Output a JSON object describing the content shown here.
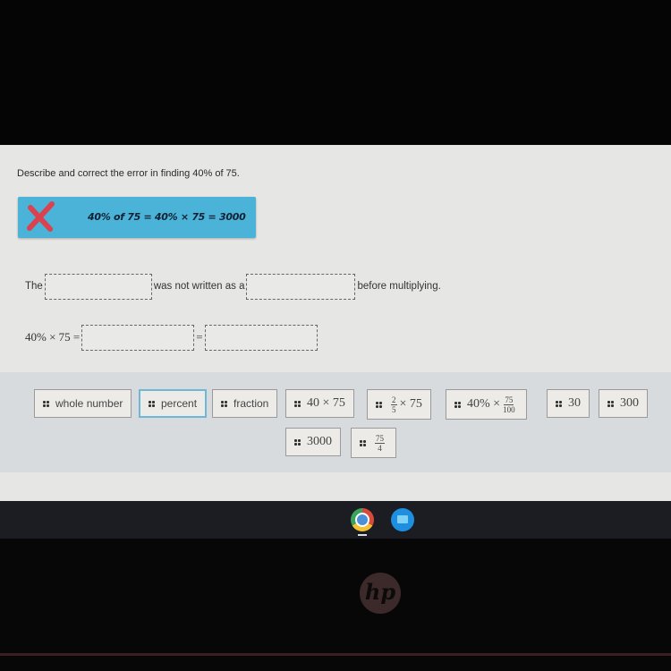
{
  "question": {
    "prompt": "Describe and correct the error in finding 40% of 75.",
    "error_work": "40% of 75 = 40% × 75 = 3000",
    "error_icon": "x-mark-icon"
  },
  "sentence": {
    "part1": "The",
    "part2": "was not written as a",
    "part3": "before multiplying."
  },
  "equation": {
    "lhs": "40% × 75 =",
    "equals": "="
  },
  "answer_bank": [
    {
      "label": "whole number",
      "type": "text"
    },
    {
      "label": "percent",
      "type": "text",
      "selected": true
    },
    {
      "label": "fraction",
      "type": "text"
    },
    {
      "label": "40 × 75",
      "type": "math"
    },
    {
      "label": "× 75",
      "type": "math",
      "frac_num": "2",
      "frac_den": "5"
    },
    {
      "label": "40% ×",
      "type": "math",
      "frac_num": "75",
      "frac_den": "100"
    },
    {
      "label": "30",
      "type": "math"
    },
    {
      "label": "300",
      "type": "math"
    },
    {
      "label": "3000",
      "type": "math"
    },
    {
      "label": "",
      "type": "math",
      "frac_num": "75",
      "frac_den": "4"
    }
  ],
  "taskbar": {
    "apps": [
      "chrome-icon",
      "files-icon"
    ]
  },
  "device": {
    "logo": "hp"
  },
  "colors": {
    "error_card": "#4bb2d8",
    "error_x": "#d9424e",
    "selected_border": "#6fb7d6"
  }
}
